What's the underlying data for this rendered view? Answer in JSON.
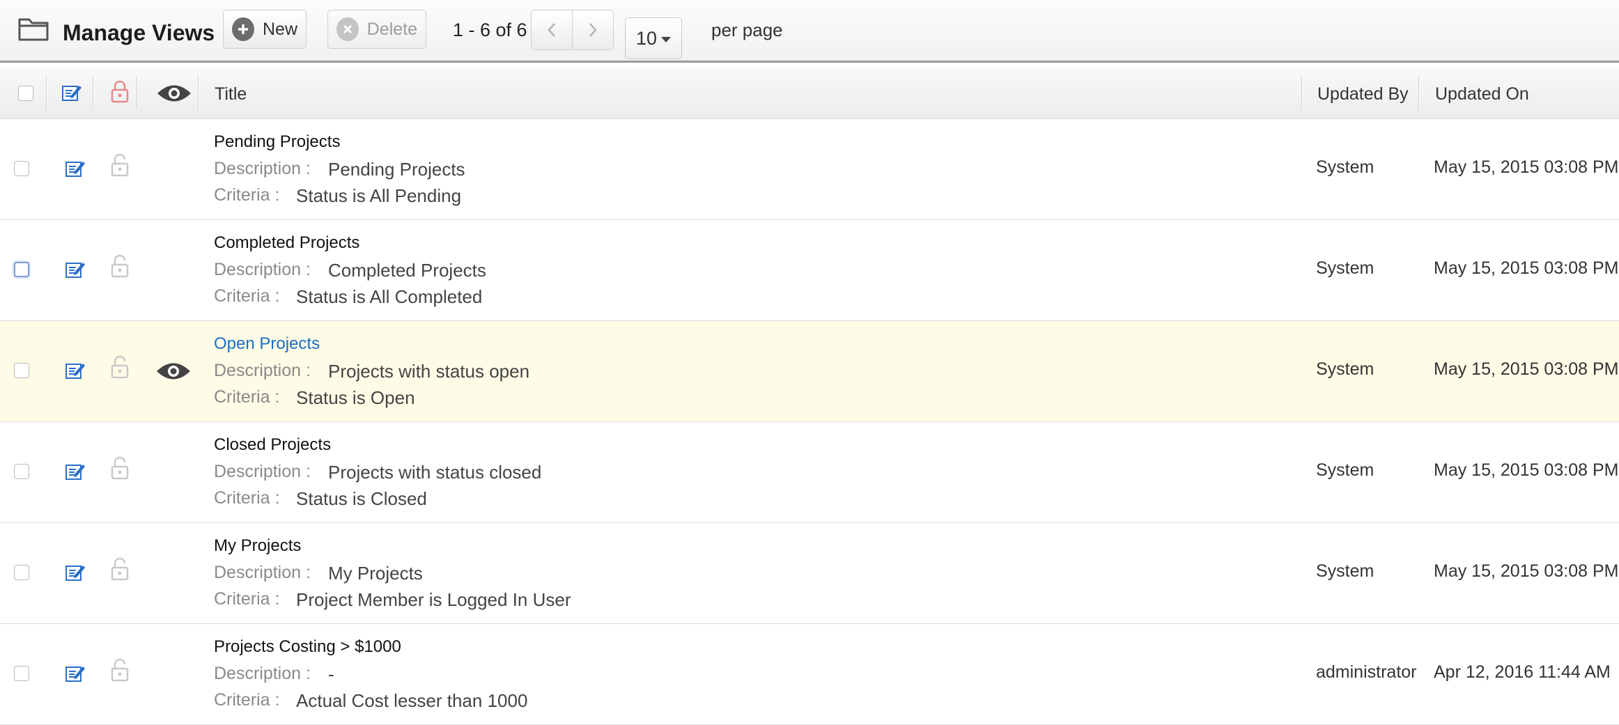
{
  "toolbar": {
    "title": "Manage Views",
    "new_label": "New",
    "delete_label": "Delete",
    "range": "1 - 6 of 6",
    "per_page_value": "10",
    "per_page_label": "per page"
  },
  "columns": {
    "title": "Title",
    "updated_by": "Updated By",
    "updated_on": "Updated On"
  },
  "labels": {
    "description": "Description :",
    "criteria": "Criteria :"
  },
  "rows": [
    {
      "title": "Pending Projects",
      "description": "Pending Projects",
      "criteria": "Status is All Pending",
      "updated_by": "System",
      "updated_on": "May 15, 2015 03:08 PM"
    },
    {
      "title": "Completed Projects",
      "description": "Completed Projects",
      "criteria": "Status is All Completed",
      "updated_by": "System",
      "updated_on": "May 15, 2015 03:08 PM"
    },
    {
      "title": "Open Projects",
      "description": "Projects with status open",
      "criteria": "Status is Open",
      "updated_by": "System",
      "updated_on": "May 15, 2015 03:08 PM"
    },
    {
      "title": "Closed Projects",
      "description": "Projects with status closed",
      "criteria": "Status is Closed",
      "updated_by": "System",
      "updated_on": "May 15, 2015 03:08 PM"
    },
    {
      "title": "My Projects",
      "description": "My Projects",
      "criteria": "Project Member is Logged In User",
      "updated_by": "System",
      "updated_on": "May 15, 2015 03:08 PM"
    },
    {
      "title": "Projects Costing > $1000",
      "description": "-",
      "criteria": "Actual Cost lesser than 1000",
      "updated_by": "administrator",
      "updated_on": "Apr 12, 2016 11:44 AM"
    }
  ],
  "colors": {
    "link": "#1a6fc4",
    "highlight_row": "#fefbe6",
    "edit_icon": "#2b6fc9",
    "lock_header": "#e8888a"
  },
  "icons": {
    "folder": "folder-icon",
    "new": "plus-circle-icon",
    "delete": "x-circle-icon",
    "prev": "chevron-left-icon",
    "next": "chevron-right-icon",
    "edit": "edit-icon",
    "lock": "lock-icon",
    "unlock": "unlock-icon",
    "default_view": "eye-icon"
  }
}
